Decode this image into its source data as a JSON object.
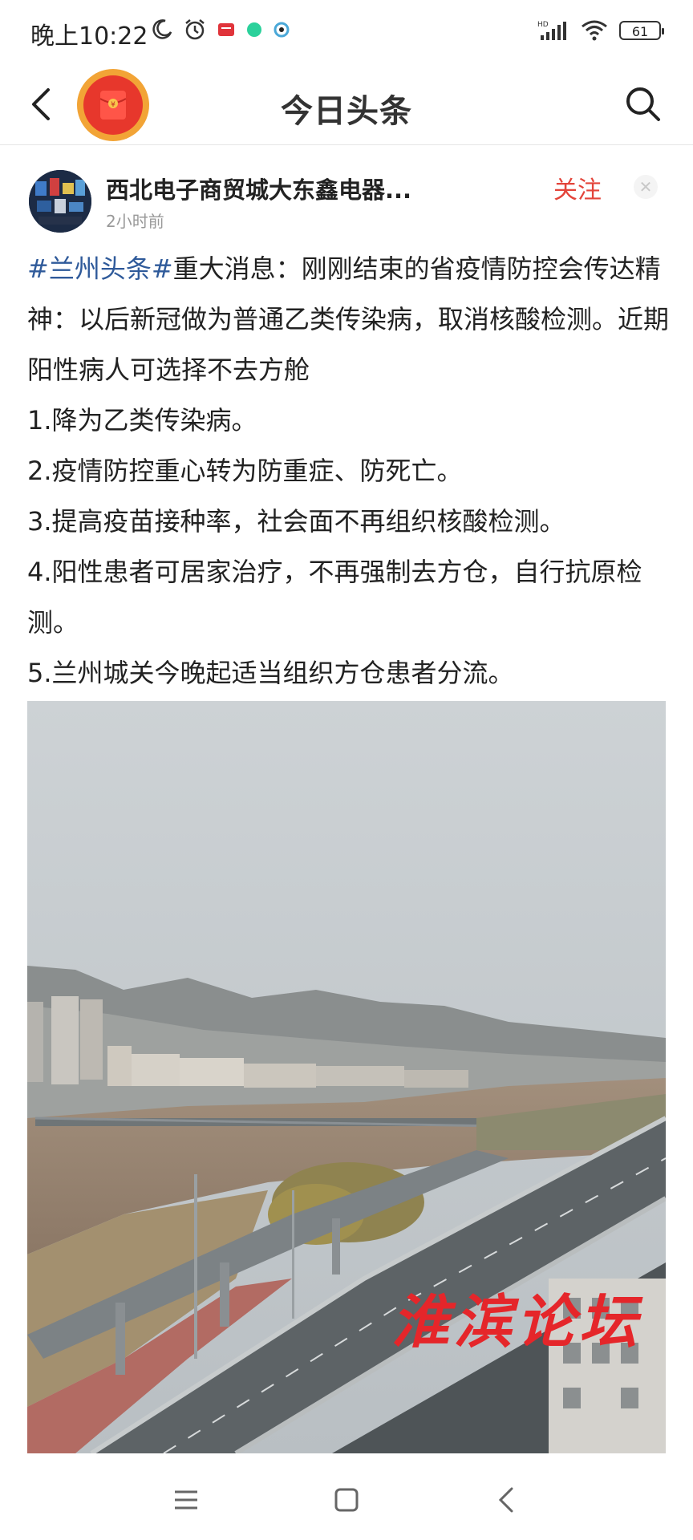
{
  "status_bar": {
    "time": "晚上10:22",
    "battery": "61",
    "network": "HD"
  },
  "nav": {
    "title": "今日头条"
  },
  "post": {
    "author": "西北电子商贸城大东鑫电器...",
    "time": "2小时前",
    "follow": "关注",
    "hashtag": "#兰州头条#",
    "intro": "重大消息：刚刚结束的省疫情防控会传达精神：以后新冠做为普通乙类传染病，取消核酸检测。近期阳性病人可选择不去方舱",
    "points": [
      "1.降为乙类传染病。",
      "2.疫情防控重心转为防重症、防死亡。",
      "3.提高疫苗接种率，社会面不再组织核酸检测。",
      "4.阳性患者可居家治疗，不再强制去方仓，自行抗原检测。",
      "5.兰州城关今晚起适当组织方仓患者分流。"
    ],
    "watermark": "淮滨论坛"
  },
  "colors": {
    "follow": "#e3443a",
    "hashtag": "#2f5a9a",
    "redpack_outer": "#f2a436",
    "redpack_inner": "#e7372c"
  },
  "icons": [
    "moon-icon",
    "alarm-icon",
    "notification-icon",
    "green-dot-icon",
    "app-icon",
    "signal-icon",
    "wifi-icon",
    "battery-icon",
    "back-icon",
    "red-packet-icon",
    "search-icon",
    "close-icon",
    "menu-icon",
    "home-icon",
    "nav-back-icon"
  ]
}
